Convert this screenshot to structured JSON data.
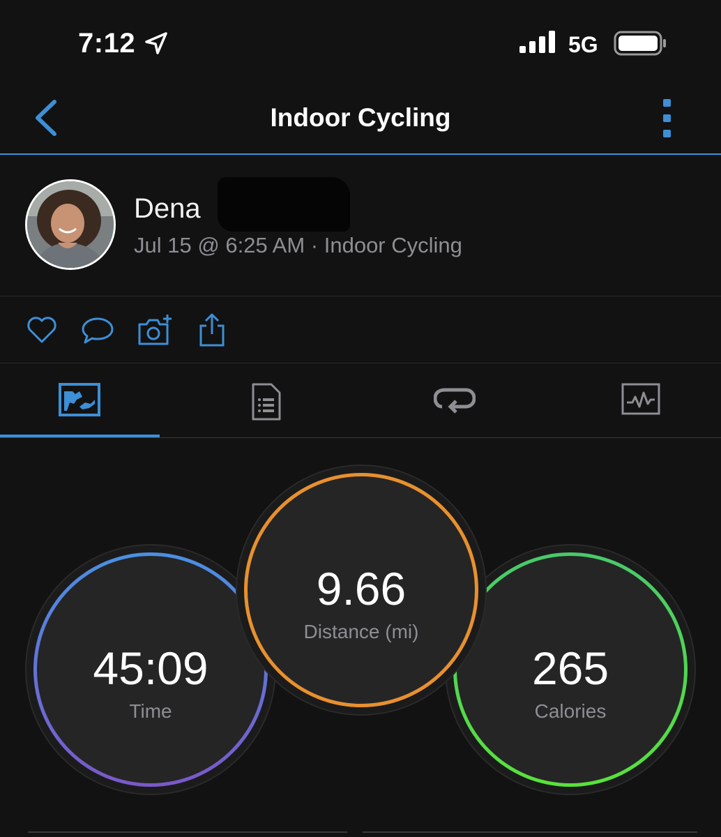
{
  "status_bar": {
    "time": "7:12",
    "network": "5G"
  },
  "nav": {
    "title": "Indoor Cycling"
  },
  "user": {
    "name": "Dena",
    "date": "Jul 15 @ 6:25 AM",
    "separator": "·",
    "activity_type": "Indoor Cycling"
  },
  "actions": [
    "heart-icon",
    "comment-icon",
    "add-photo-icon",
    "share-icon"
  ],
  "tabs": [
    {
      "icon": "overview-map-icon",
      "selected": true
    },
    {
      "icon": "details-list-icon",
      "selected": false
    },
    {
      "icon": "laps-icon",
      "selected": false
    },
    {
      "icon": "charts-icon",
      "selected": false
    }
  ],
  "stats": {
    "time": {
      "value": "45:09",
      "label": "Time",
      "color": "#4a90e2"
    },
    "distance": {
      "value": "9.66",
      "label": "Distance (mi)",
      "color": "#e8902e"
    },
    "calories": {
      "value": "265",
      "label": "Calories",
      "color": "#49c96a"
    }
  },
  "colors": {
    "accent": "#3d8fd6",
    "background": "#121212"
  }
}
